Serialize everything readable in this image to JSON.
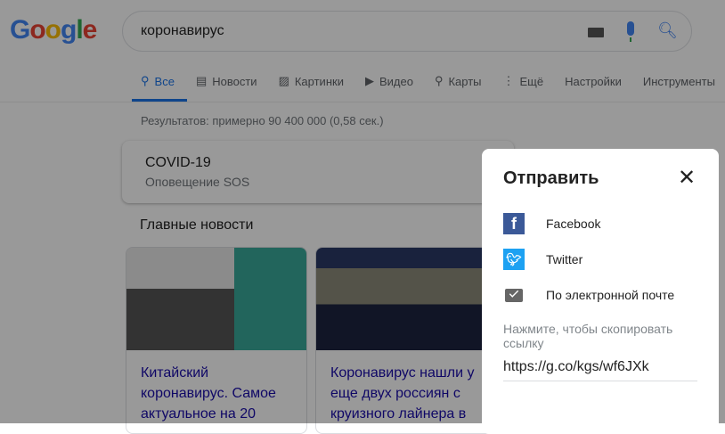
{
  "logo": "Google",
  "search": {
    "query": "коронавирус"
  },
  "tabs": [
    {
      "label": "Все"
    },
    {
      "label": "Новости"
    },
    {
      "label": "Картинки"
    },
    {
      "label": "Видео"
    },
    {
      "label": "Карты"
    },
    {
      "label": "Ещё"
    },
    {
      "label": "Настройки"
    },
    {
      "label": "Инструменты"
    }
  ],
  "stats": "Результатов: примерно 90 400 000 (0,58 сек.)",
  "covid": {
    "title": "COVID-19",
    "subtitle": "Оповещение SOS"
  },
  "news": {
    "heading": "Главные новости",
    "cards": [
      {
        "title": "Китайский коронавирус. Самое актуальное на 20"
      },
      {
        "title": "Коронавирус нашли у еще двух россиян с круизного лайнера в"
      }
    ]
  },
  "share": {
    "title": "Отправить",
    "options": [
      {
        "label": "Facebook"
      },
      {
        "label": "Twitter"
      },
      {
        "label": "По электронной почте"
      }
    ],
    "hint": "Нажмите, чтобы скопировать ссылку",
    "link": "https://g.co/kgs/wf6JXk"
  },
  "colors": {
    "facebook": "#3b5998",
    "twitter": "#1da1f2",
    "accent": "#1a73e8"
  }
}
